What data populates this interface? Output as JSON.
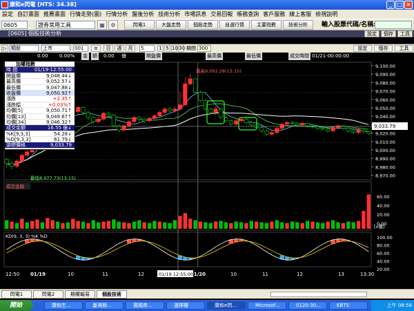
{
  "window": {
    "title": "康和e閃電  [HTS: 34.38]"
  },
  "menu": [
    "設定",
    "自訂畫面",
    "推薦畫面",
    "行情走勢(圖)",
    "行情分析",
    "盤後分析",
    "技術分析",
    "市場訊息",
    "交易回報",
    "帳務查詢",
    "客戶服務",
    "線上客服",
    "檢視說明"
  ],
  "toolbar": {
    "code_value": "0605",
    "tool_select": "證券常用工具",
    "buttons": [
      "閃電1",
      "大盤走勢",
      "個股走勢",
      "自選行情",
      "主要指數",
      "技術分析"
    ],
    "input_label": "輸入股票代碼/名稱:",
    "input_value": ""
  },
  "panel": {
    "header": "[0605] 個股技術分析",
    "buttons": [
      "設定",
      "個存",
      "工具"
    ]
  },
  "controls": {
    "type": "類股",
    "market": "上市",
    "code": "001",
    "period_buttons": [
      "日",
      "週",
      "月"
    ],
    "minute_value": "5",
    "range_buttons": [
      "1",
      "5",
      "10",
      "30"
    ],
    "period_label": "期間",
    "period_value": "300"
  },
  "infobar": {
    "v1": "0.00",
    "v2": "0.00%",
    "amount_label": "金",
    "amount_label2": "額",
    "amount_value": "0.00",
    "amount_unit": "億",
    "open_label": "開盤價",
    "high_label": "最高價",
    "low_label": "最低價",
    "time_label": "成交時間",
    "time_value": "01/21-00:00:00"
  },
  "leftbox": {
    "title": "加權指數",
    "rows": [
      {
        "k": "時 間",
        "v": "01/19-12:55:00",
        "style": "hl"
      },
      {
        "k": "開盤價",
        "v": "9,048.44↓"
      },
      {
        "k": "最高價",
        "v": "9,052.57↓"
      },
      {
        "k": "最低價",
        "v": "9,047.88↓"
      },
      {
        "k": "收盤價",
        "v": "9,050.92↑",
        "style": "hl2"
      },
      {
        "k": "漲跌",
        "v": "+2.35↑",
        "style": "rd"
      },
      {
        "k": "漲跌幅",
        "v": "+0.03%↑",
        "style": "rd"
      },
      {
        "k": "均價[5]",
        "v": "9,050.71↑"
      },
      {
        "k": "均價[13]",
        "v": "9,049.67↑"
      },
      {
        "k": "均價[34]",
        "v": "9,046.32↑"
      },
      {
        "k": "成交金額",
        "v": "16.55 億↓",
        "style": "hl"
      },
      {
        "k": "%K[9,3,3]",
        "v": "54.28↓"
      },
      {
        "k": "%D[9,3,3]",
        "v": "61.79↓"
      },
      {
        "k": "游標價格",
        "v": "9,033.79",
        "style": "hl"
      }
    ]
  },
  "chart_data": {
    "type": "candlestick",
    "price_axis": [
      "9,100.00",
      "9,090.00",
      "9,080.00",
      "9,070.00",
      "9,060.00",
      "9,050.00",
      "9,040.00",
      "9,030.00",
      "9,020.00",
      "9,010.00",
      "9,000.00",
      "8,990.00",
      "8,980.00",
      "8,970.00"
    ],
    "ylim": [
      8970,
      9100
    ],
    "annotations": {
      "high": "最高9,092.28(13:15)",
      "low": "最低8,977.73(13:15)"
    },
    "cursor_price": "9,033.79",
    "cursor_time": "01/19 12:55:00",
    "volume_label": "成交金額",
    "volume_axis": [
      "60.00",
      "40.00",
      "20.00",
      "0.00"
    ],
    "volume_unit": "[x億]",
    "kd_label": "KD(9, 3, 3) %K %D",
    "kd_axis": [
      "100.00",
      "80.00",
      "60.00",
      "40.00",
      "20.00"
    ],
    "time_axis": [
      "12:50",
      "01/19",
      "10",
      "11",
      "12",
      "01/20",
      "10",
      "11",
      "12",
      "13",
      "13:30"
    ],
    "candles": [
      [
        8990,
        8985,
        8992,
        8980
      ],
      [
        8985,
        8982,
        8988,
        8978
      ],
      [
        8982,
        8988,
        8990,
        8980
      ],
      [
        8988,
        8995,
        8997,
        8986
      ],
      [
        8995,
        8999,
        9001,
        8992
      ],
      [
        8999,
        9010,
        9012,
        8997
      ],
      [
        9010,
        9015,
        9017,
        9007
      ],
      [
        9015,
        9020,
        9022,
        9012
      ],
      [
        9020,
        9030,
        9032,
        9018
      ],
      [
        9030,
        9038,
        9040,
        9028
      ],
      [
        9038,
        9042,
        9045,
        9035
      ],
      [
        9042,
        9036,
        9044,
        9034
      ],
      [
        9036,
        9040,
        9042,
        9033
      ],
      [
        9040,
        9047,
        9050,
        9038
      ],
      [
        9047,
        9052,
        9054,
        9044
      ],
      [
        9052,
        9046,
        9053,
        9043
      ],
      [
        9046,
        9040,
        9048,
        9037
      ],
      [
        9040,
        9035,
        9042,
        9032
      ],
      [
        9035,
        9038,
        9041,
        9033
      ],
      [
        9038,
        9045,
        9047,
        9036
      ],
      [
        9045,
        9043,
        9047,
        9040
      ],
      [
        9043,
        9030,
        9044,
        9028
      ],
      [
        9030,
        9025,
        9032,
        9022
      ],
      [
        9025,
        9030,
        9032,
        9023
      ],
      [
        9030,
        9035,
        9037,
        9028
      ],
      [
        9035,
        9040,
        9042,
        9033
      ],
      [
        9040,
        9038,
        9042,
        9035
      ],
      [
        9038,
        9036,
        9040,
        9033
      ],
      [
        9036,
        9039,
        9041,
        9034
      ],
      [
        9039,
        9042,
        9044,
        9037
      ],
      [
        9042,
        9046,
        9048,
        9040
      ],
      [
        9046,
        9050,
        9052,
        9044
      ],
      [
        9050,
        9048,
        9052,
        9046
      ],
      [
        9048,
        9050,
        9053,
        9046
      ],
      [
        9050,
        9055,
        9070,
        9048
      ],
      [
        9055,
        9080,
        9088,
        9053
      ],
      [
        9080,
        9086,
        9092,
        9078
      ],
      [
        9086,
        9070,
        9087,
        9068
      ],
      [
        9070,
        9060,
        9072,
        9058
      ],
      [
        9060,
        9050,
        9062,
        9048
      ],
      [
        9050,
        9046,
        9052,
        9044
      ],
      [
        9046,
        9050,
        9053,
        9043
      ],
      [
        9050,
        9040,
        9052,
        9038
      ],
      [
        9040,
        9036,
        9042,
        9034
      ],
      [
        9036,
        9032,
        9038,
        9030
      ],
      [
        9032,
        9036,
        9038,
        9030
      ],
      [
        9036,
        9038,
        9040,
        9034
      ],
      [
        9038,
        9034,
        9040,
        9032
      ],
      [
        9034,
        9031,
        9036,
        9029
      ],
      [
        9031,
        9028,
        9033,
        9026
      ],
      [
        9028,
        9024,
        9030,
        9022
      ],
      [
        9024,
        9020,
        9026,
        9018
      ],
      [
        9020,
        9022,
        9025,
        9018
      ],
      [
        9022,
        9027,
        9029,
        9020
      ],
      [
        9027,
        9032,
        9034,
        9025
      ],
      [
        9032,
        9034,
        9036,
        9030
      ],
      [
        9034,
        9033,
        9036,
        9031
      ],
      [
        9033,
        9031,
        9035,
        9029
      ],
      [
        9031,
        9033,
        9035,
        9029
      ],
      [
        9033,
        9030,
        9034,
        9028
      ],
      [
        9030,
        9029,
        9032,
        9027
      ],
      [
        9029,
        9027,
        9030,
        9025
      ],
      [
        9027,
        9026,
        9029,
        9024
      ],
      [
        9026,
        9024,
        9028,
        9022
      ],
      [
        9024,
        9028,
        9030,
        9022
      ],
      [
        9028,
        9030,
        9032,
        9026
      ],
      [
        9030,
        9027,
        9031,
        9025
      ],
      [
        9027,
        9024,
        9029,
        9022
      ],
      [
        9024,
        9022,
        9026,
        9020
      ],
      [
        9022,
        9025,
        9027,
        9020
      ],
      [
        9025,
        9023,
        9027,
        9021
      ],
      [
        9023,
        9021,
        9024,
        9019
      ]
    ],
    "volumes": [
      12,
      10,
      8,
      14,
      9,
      11,
      13,
      9,
      15,
      12,
      10,
      8,
      9,
      14,
      11,
      10,
      8,
      12,
      9,
      10,
      11,
      13,
      10,
      9,
      8,
      10,
      12,
      9,
      8,
      11,
      10,
      9,
      8,
      12,
      18,
      22,
      14,
      12,
      10,
      9,
      8,
      10,
      11,
      9,
      8,
      10,
      9,
      8,
      11,
      10,
      9,
      8,
      10,
      12,
      9,
      8,
      10,
      9,
      8,
      11,
      10,
      9,
      8,
      10,
      12,
      9,
      8,
      10,
      9,
      11,
      25,
      48
    ],
    "volume_colors": [
      "g",
      "r",
      "g",
      "r",
      "g",
      "r",
      "r",
      "g",
      "r",
      "r",
      "g",
      "r",
      "g",
      "r",
      "r",
      "g",
      "r",
      "g",
      "g",
      "r",
      "r",
      "g",
      "g",
      "r",
      "r",
      "g",
      "g",
      "r",
      "g",
      "g",
      "r",
      "g",
      "g",
      "g",
      "r",
      "r",
      "r",
      "g",
      "r",
      "g",
      "g",
      "r",
      "g",
      "g",
      "r",
      "g",
      "g",
      "r",
      "g",
      "r",
      "g",
      "g",
      "r",
      "g",
      "g",
      "r",
      "g",
      "g",
      "r",
      "g",
      "r",
      "g",
      "g",
      "r",
      "g",
      "g",
      "r",
      "g",
      "g",
      "r",
      "r",
      "r"
    ]
  },
  "sheet_tabs": [
    "閃電1",
    "閃電2",
    "期權報易",
    "個股技術"
  ],
  "taskbar": {
    "start": "開始",
    "tasks": [
      "康和生...",
      "臺灣期...",
      "置碼券...",
      "選擇權",
      "康和e閃...",
      "Microsof...",
      "0120-30...",
      "EBTS"
    ],
    "clock": "上午 08:58"
  },
  "colors": {
    "up": "#ff3030",
    "down": "#00c000",
    "ma5": "#66ccff",
    "ma13": "#55dd55",
    "ma34": "#ffffff"
  }
}
